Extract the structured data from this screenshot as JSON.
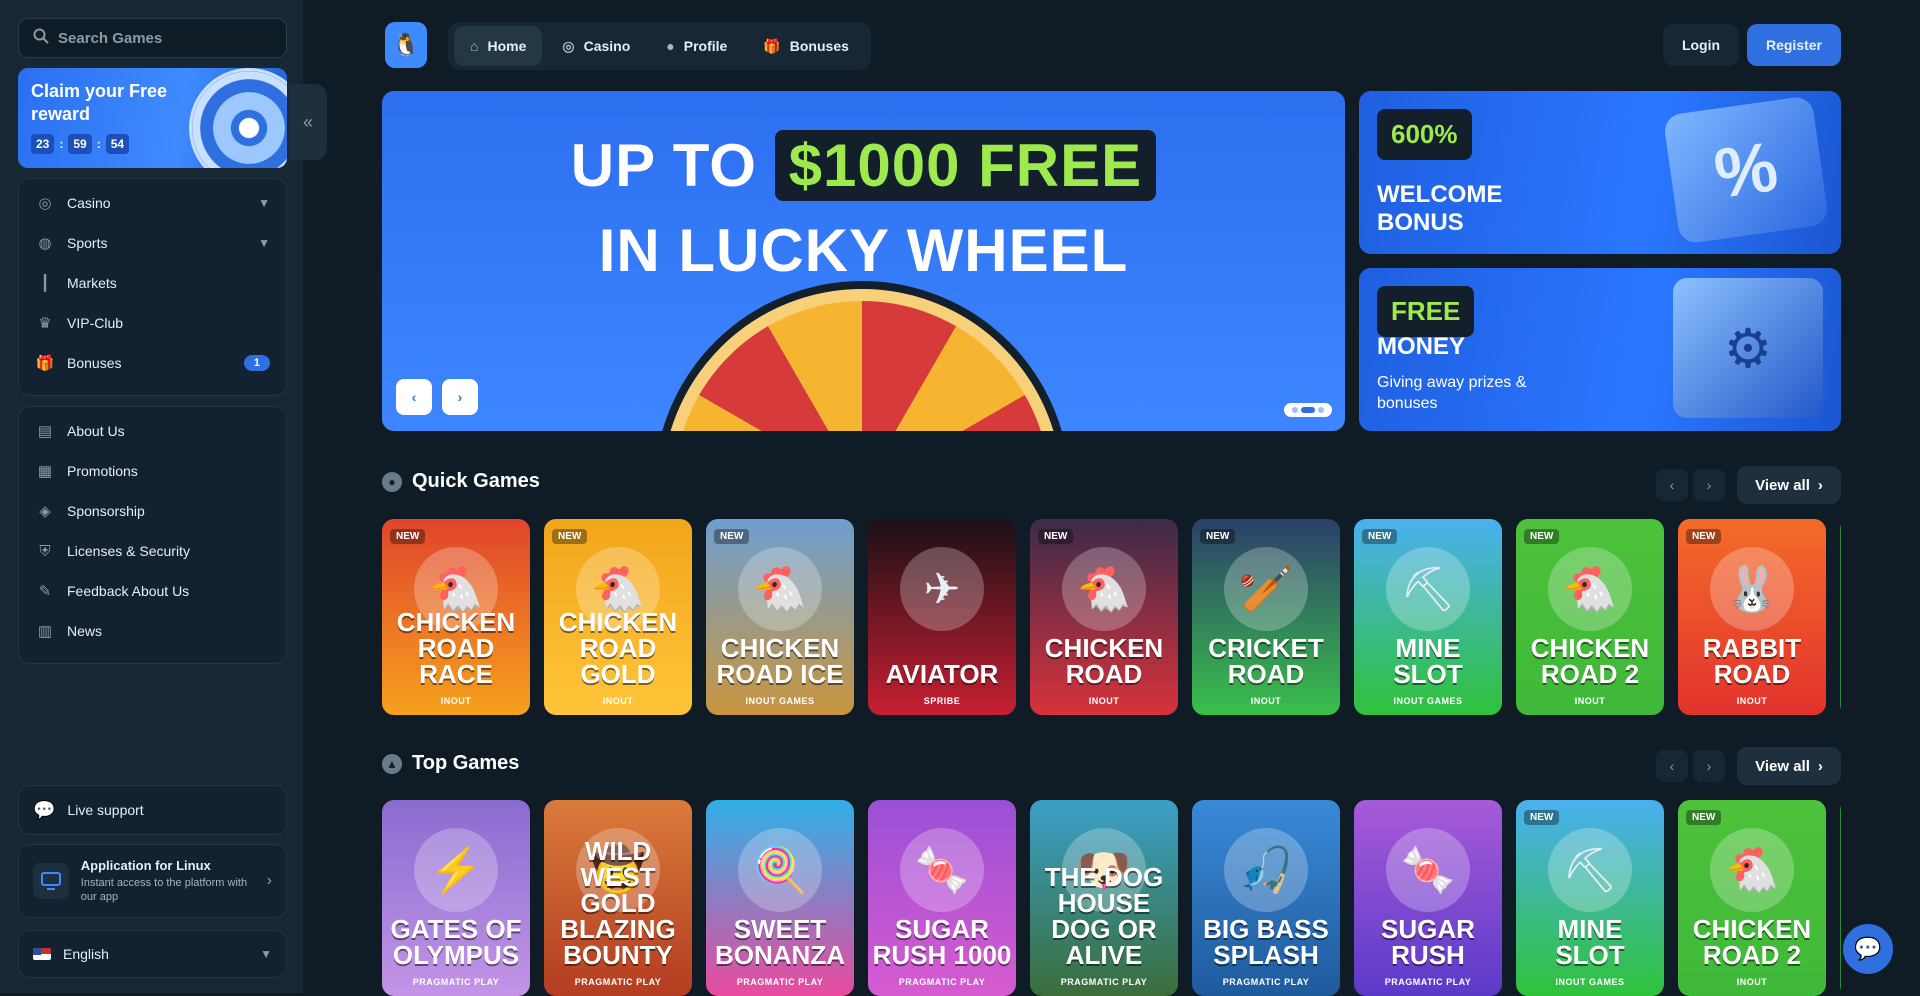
{
  "search": {
    "placeholder": "Search Games"
  },
  "reward": {
    "title": "Claim your Free reward",
    "timer": [
      "23",
      "59",
      "54"
    ]
  },
  "sidebar": {
    "main_items": [
      {
        "label": "Casino",
        "icon": "casino-chip-icon",
        "has_chevron": true
      },
      {
        "label": "Sports",
        "icon": "globe-icon",
        "has_chevron": true
      },
      {
        "label": "Markets",
        "icon": "candles-icon"
      },
      {
        "label": "VIP-Club",
        "icon": "crown-icon"
      },
      {
        "label": "Bonuses",
        "icon": "gift-icon",
        "badge": "1"
      }
    ],
    "info_items": [
      {
        "label": "About Us",
        "icon": "book-icon"
      },
      {
        "label": "Promotions",
        "icon": "ticket-icon"
      },
      {
        "label": "Sponsorship",
        "icon": "medal-icon"
      },
      {
        "label": "Licenses & Security",
        "icon": "shield-icon"
      },
      {
        "label": "Feedback About Us",
        "icon": "feedback-icon"
      },
      {
        "label": "News",
        "icon": "newspaper-icon"
      }
    ],
    "live_support": "Live support",
    "app": {
      "title": "Application for Linux",
      "subtitle": "Instant access to the platform with our app"
    },
    "language": "English"
  },
  "nav": {
    "tabs": [
      {
        "label": "Home",
        "icon": "home-icon",
        "active": true
      },
      {
        "label": "Casino",
        "icon": "casino-chip-icon"
      },
      {
        "label": "Profile",
        "icon": "user-icon"
      },
      {
        "label": "Bonuses",
        "icon": "gift-icon"
      }
    ],
    "login": "Login",
    "register": "Register"
  },
  "hero": {
    "line1_prefix": "UP TO",
    "line1_highlight": "$1000 FREE",
    "line2": "IN LUCKY WHEEL"
  },
  "promos": [
    {
      "tag": "600%",
      "title": "WELCOME BONUS"
    },
    {
      "tag": "FREE",
      "title": "MONEY",
      "subtitle": "Giving away prizes & bonuses"
    }
  ],
  "sections": {
    "quick": {
      "title": "Quick Games",
      "view_all": "View all"
    },
    "top": {
      "title": "Top Games",
      "view_all": "View all"
    }
  },
  "quick_games": [
    {
      "name": "CHICKEN ROAD RACE",
      "provider": "INOUT",
      "new": true,
      "color": "#e0452c",
      "color2": "#f6a11d",
      "emoji": "🐔"
    },
    {
      "name": "CHICKEN ROAD GOLD",
      "provider": "INOUT",
      "new": true,
      "color": "#f2a51b",
      "color2": "#ffc53a",
      "emoji": "🐔"
    },
    {
      "name": "CHICKEN ROAD ICE",
      "provider": "INOUT GAMES",
      "new": true,
      "color": "#6e9fd0",
      "color2": "#c8953e",
      "emoji": "🐔"
    },
    {
      "name": "AVIATOR",
      "provider": "SPRIBE",
      "new": false,
      "color": "#1b1015",
      "color2": "#c81f33",
      "emoji": "✈"
    },
    {
      "name": "CHICKEN ROAD",
      "provider": "INOUT",
      "new": true,
      "color": "#3c2a4a",
      "color2": "#d8323a",
      "emoji": "🐔"
    },
    {
      "name": "CRICKET ROAD",
      "provider": "INOUT",
      "new": true,
      "color": "#2b3f6a",
      "color2": "#39c04a",
      "emoji": "🏏"
    },
    {
      "name": "MINE SLOT",
      "provider": "INOUT GAMES",
      "new": true,
      "color": "#4ab0f0",
      "color2": "#30c23a",
      "emoji": "⛏"
    },
    {
      "name": "CHICKEN ROAD 2",
      "provider": "INOUT",
      "new": true,
      "color": "#4dc23a",
      "color2": "#3fb83a",
      "emoji": "🐔"
    },
    {
      "name": "RABBIT ROAD",
      "provider": "INOUT",
      "new": true,
      "color": "#f46b2a",
      "color2": "#e2332c",
      "emoji": "🐰"
    }
  ],
  "top_games": [
    {
      "name": "GATES OF OLYMPUS",
      "provider": "PRAGMATIC PLAY",
      "new": false,
      "color": "#8a6cd0",
      "color2": "#c394e6",
      "emoji": "⚡"
    },
    {
      "name": "WILD WEST GOLD BLAZING BOUNTY",
      "provider": "PRAGMATIC PLAY",
      "new": false,
      "color": "#d97a3a",
      "color2": "#b33d21",
      "emoji": "🤠"
    },
    {
      "name": "SWEET BONANZA",
      "provider": "PRAGMATIC PLAY",
      "new": false,
      "color": "#2fb0e6",
      "color2": "#ea4a9d",
      "emoji": "🍭"
    },
    {
      "name": "SUGAR RUSH 1000",
      "provider": "PRAGMATIC PLAY",
      "new": false,
      "color": "#9b4fd6",
      "color2": "#d75bd0",
      "emoji": "🍬"
    },
    {
      "name": "THE DOG HOUSE DOG OR ALIVE",
      "provider": "PRAGMATIC PLAY",
      "new": false,
      "color": "#3aa0c8",
      "color2": "#3a6d3a",
      "emoji": "🐶"
    },
    {
      "name": "BIG BASS SPLASH",
      "provider": "PRAGMATIC PLAY",
      "new": false,
      "color": "#3a8ad8",
      "color2": "#1f5a9c",
      "emoji": "🎣"
    },
    {
      "name": "SUGAR RUSH",
      "provider": "PRAGMATIC PLAY",
      "new": false,
      "color": "#a75ad8",
      "color2": "#5a3ac8",
      "emoji": "🍬"
    },
    {
      "name": "MINE SLOT",
      "provider": "INOUT GAMES",
      "new": true,
      "color": "#4ab0f0",
      "color2": "#30c23a",
      "emoji": "⛏"
    },
    {
      "name": "CHICKEN ROAD 2",
      "provider": "INOUT",
      "new": true,
      "color": "#4dc23a",
      "color2": "#3fb83a",
      "emoji": "🐔"
    }
  ]
}
